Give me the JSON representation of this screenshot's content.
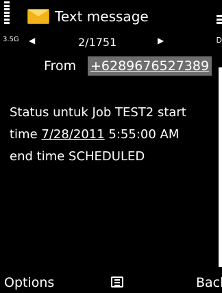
{
  "status": {
    "network_label": "3.5G",
    "battery_label": "D"
  },
  "header": {
    "title": "Text message",
    "icon": "envelope-icon"
  },
  "navigation": {
    "position": "2/1751",
    "prev_icon": "left-arrow",
    "next_icon": "right-arrow"
  },
  "from": {
    "label": "From",
    "number": "+6289676527389"
  },
  "message": {
    "line1": "Status untuk Job TEST2 start",
    "line2_prefix": "time ",
    "line2_date": "7/28/2011",
    "line2_time": " 5:55:00 AM",
    "line3": "end time  SCHEDULED"
  },
  "softkeys": {
    "left": "Options",
    "middle_icon": "menu-icon",
    "right": "Back"
  },
  "colors": {
    "background": "#000000",
    "highlight": "#6e6e6e",
    "envelope": "#f2b21a"
  }
}
